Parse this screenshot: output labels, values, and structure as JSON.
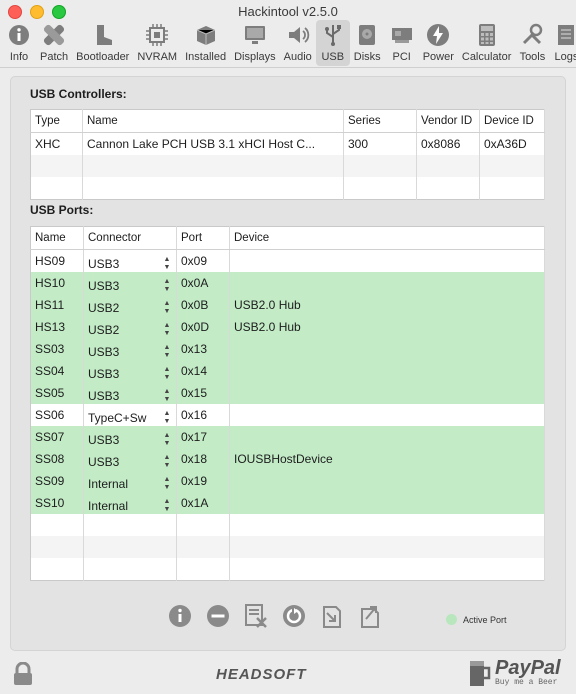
{
  "window": {
    "title": "Hackintool v2.5.0"
  },
  "toolbar": {
    "items": [
      {
        "label": "Info",
        "icon": "info-icon"
      },
      {
        "label": "Patch",
        "icon": "bandage-icon"
      },
      {
        "label": "Bootloader",
        "icon": "boot-icon"
      },
      {
        "label": "NVRAM",
        "icon": "chip-icon"
      },
      {
        "label": "Installed",
        "icon": "package-icon"
      },
      {
        "label": "Displays",
        "icon": "monitor-icon"
      },
      {
        "label": "Audio",
        "icon": "speaker-icon"
      },
      {
        "label": "USB",
        "icon": "usb-icon",
        "active": true
      },
      {
        "label": "Disks",
        "icon": "disk-icon"
      },
      {
        "label": "PCI",
        "icon": "pci-card-icon"
      },
      {
        "label": "Power",
        "icon": "power-bolt-icon"
      },
      {
        "label": "Calculator",
        "icon": "calculator-icon"
      },
      {
        "label": "Tools",
        "icon": "tools-icon"
      },
      {
        "label": "Logs",
        "icon": "logs-icon"
      }
    ]
  },
  "controllers": {
    "title": "USB Controllers:",
    "headers": [
      "Type",
      "Name",
      "Series",
      "Vendor ID",
      "Device ID"
    ],
    "rows": [
      {
        "type": "XHC",
        "name": "Cannon Lake PCH USB 3.1 xHCI Host C...",
        "series": "300",
        "vendor_id": "0x8086",
        "device_id": "0xA36D"
      }
    ]
  },
  "ports": {
    "title": "USB Ports:",
    "headers": [
      "Name",
      "Connector",
      "Port",
      "Device"
    ],
    "rows": [
      {
        "name": "HS09",
        "connector": "USB3",
        "port": "0x09",
        "device": "",
        "active": false
      },
      {
        "name": "HS10",
        "connector": "USB3",
        "port": "0x0A",
        "device": "",
        "active": true
      },
      {
        "name": "HS11",
        "connector": "USB2",
        "port": "0x0B",
        "device": "USB2.0 Hub",
        "active": true
      },
      {
        "name": "HS13",
        "connector": "USB2",
        "port": "0x0D",
        "device": "USB2.0 Hub",
        "active": true
      },
      {
        "name": "SS03",
        "connector": "USB3",
        "port": "0x13",
        "device": "",
        "active": true
      },
      {
        "name": "SS04",
        "connector": "USB3",
        "port": "0x14",
        "device": "",
        "active": true
      },
      {
        "name": "SS05",
        "connector": "USB3",
        "port": "0x15",
        "device": "",
        "active": true
      },
      {
        "name": "SS06",
        "connector": "TypeC+Sw",
        "port": "0x16",
        "device": "",
        "active": false
      },
      {
        "name": "SS07",
        "connector": "USB3",
        "port": "0x17",
        "device": "",
        "active": true
      },
      {
        "name": "SS08",
        "connector": "USB3",
        "port": "0x18",
        "device": "IOUSBHostDevice",
        "active": true
      },
      {
        "name": "SS09",
        "connector": "Internal",
        "port": "0x19",
        "device": "",
        "active": true
      },
      {
        "name": "SS10",
        "connector": "Internal",
        "port": "0x1A",
        "device": "",
        "active": true
      }
    ]
  },
  "bottom_actions": [
    "info-circle-icon",
    "remove-circle-icon",
    "delete-doc-icon",
    "refresh-icon",
    "import-doc-icon",
    "export-doc-icon"
  ],
  "legend": {
    "label": "Active Port",
    "color": "#b8e6bd"
  },
  "footer": {
    "brand": "HEADSOFT",
    "donate": "PayPal",
    "donate_sub": "Buy me a Beer"
  },
  "colors": {
    "active_row": "#c2ebc6",
    "panel": "#e3e3e3"
  }
}
